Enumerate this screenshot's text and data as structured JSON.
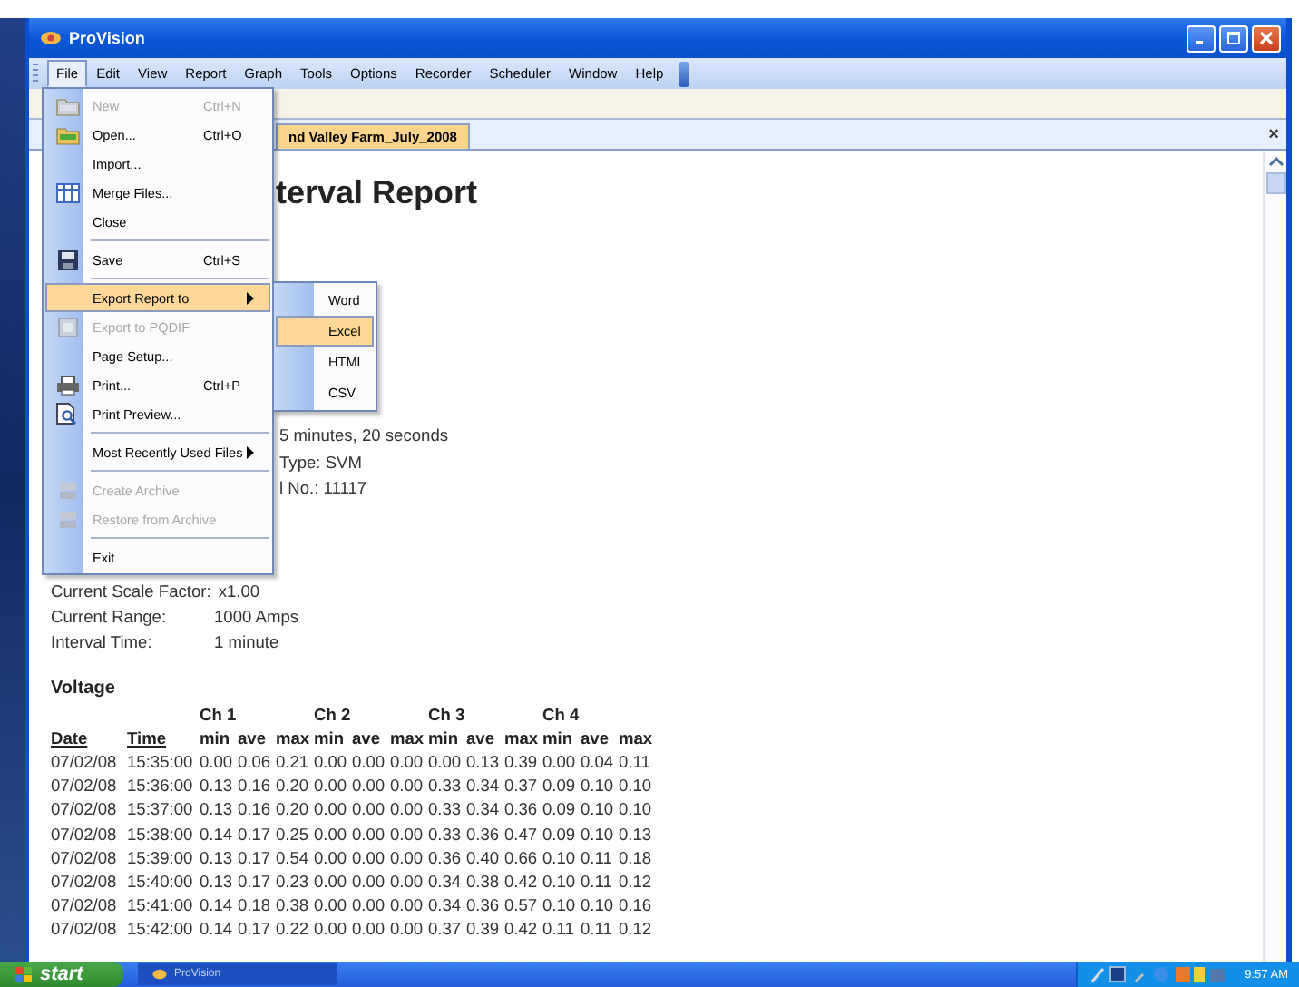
{
  "window": {
    "title": "ProVision"
  },
  "menu_bar": [
    {
      "label": "File",
      "selected": true
    },
    {
      "label": "Edit",
      "selected": false
    },
    {
      "label": "View",
      "selected": false
    },
    {
      "label": "Report",
      "selected": false
    },
    {
      "label": "Graph",
      "selected": false
    },
    {
      "label": "Tools",
      "selected": false
    },
    {
      "label": "Options",
      "selected": false
    },
    {
      "label": "Recorder",
      "selected": false
    },
    {
      "label": "Scheduler",
      "selected": false
    },
    {
      "label": "Window",
      "selected": false
    },
    {
      "label": "Help",
      "selected": false
    }
  ],
  "document_tab": {
    "label": "nd Valley Farm_July_2008",
    "selected": true
  },
  "tab_close": "×",
  "report": {
    "title": "terval Report",
    "info_lines": [
      "5 minutes, 20 seconds",
      "Type:  SVM",
      "l No.: 11117"
    ],
    "settings": [
      {
        "label": "Current Scale Factor:",
        "value": "x1.00"
      },
      {
        "label": "Current Range:",
        "value": "1000 Amps"
      },
      {
        "label": "Interval Time:",
        "value": "1 minute"
      }
    ],
    "section": "Voltage",
    "table": {
      "channels": [
        "Ch 1",
        "Ch 2",
        "Ch 3",
        "Ch 4"
      ],
      "columns": [
        "Date",
        "Time",
        "min",
        "ave",
        "max",
        "min",
        "ave",
        "max",
        "min",
        "ave",
        "max",
        "min",
        "ave",
        "max"
      ],
      "rows": [
        [
          "07/02/08",
          "15:35:00",
          "0.00",
          "0.06",
          "0.21",
          "0.00",
          "0.00",
          "0.00",
          "0.00",
          "0.13",
          "0.39",
          "0.00",
          "0.04",
          "0.11"
        ],
        [
          "07/02/08",
          "15:36:00",
          "0.13",
          "0.16",
          "0.20",
          "0.00",
          "0.00",
          "0.00",
          "0.33",
          "0.34",
          "0.37",
          "0.09",
          "0.10",
          "0.10"
        ],
        [
          "07/02/08",
          "15:37:00",
          "0.13",
          "0.16",
          "0.20",
          "0.00",
          "0.00",
          "0.00",
          "0.33",
          "0.34",
          "0.36",
          "0.09",
          "0.10",
          "0.10"
        ],
        [
          "07/02/08",
          "15:38:00",
          "0.14",
          "0.17",
          "0.25",
          "0.00",
          "0.00",
          "0.00",
          "0.33",
          "0.36",
          "0.47",
          "0.09",
          "0.10",
          "0.13"
        ],
        [
          "07/02/08",
          "15:39:00",
          "0.13",
          "0.17",
          "0.54",
          "0.00",
          "0.00",
          "0.00",
          "0.36",
          "0.40",
          "0.66",
          "0.10",
          "0.11",
          "0.18"
        ],
        [
          "07/02/08",
          "15:40:00",
          "0.13",
          "0.17",
          "0.23",
          "0.00",
          "0.00",
          "0.00",
          "0.34",
          "0.38",
          "0.42",
          "0.10",
          "0.11",
          "0.12"
        ],
        [
          "07/02/08",
          "15:41:00",
          "0.14",
          "0.18",
          "0.38",
          "0.00",
          "0.00",
          "0.00",
          "0.34",
          "0.36",
          "0.57",
          "0.10",
          "0.10",
          "0.16"
        ],
        [
          "07/02/08",
          "15:42:00",
          "0.14",
          "0.17",
          "0.22",
          "0.00",
          "0.00",
          "0.00",
          "0.37",
          "0.39",
          "0.42",
          "0.11",
          "0.11",
          "0.12"
        ]
      ]
    }
  },
  "file_menu": {
    "items": [
      {
        "kind": "item",
        "label": "New",
        "shortcut": "Ctrl+N",
        "disabled": true,
        "selected": false,
        "submenu": false
      },
      {
        "kind": "item",
        "label": "Open...",
        "shortcut": "Ctrl+O",
        "disabled": false,
        "selected": false,
        "submenu": false
      },
      {
        "kind": "item",
        "label": "Import...",
        "disabled": false,
        "selected": false,
        "submenu": false
      },
      {
        "kind": "item",
        "label": "Merge Files...",
        "disabled": false,
        "selected": false,
        "submenu": false
      },
      {
        "kind": "item",
        "label": "Close",
        "disabled": false,
        "selected": false,
        "submenu": false
      },
      {
        "kind": "separator"
      },
      {
        "kind": "item",
        "label": "Save",
        "shortcut": "Ctrl+S",
        "disabled": false,
        "selected": false,
        "submenu": false
      },
      {
        "kind": "separator"
      },
      {
        "kind": "item",
        "label": "Export Report to",
        "disabled": false,
        "selected": true,
        "submenu": true
      },
      {
        "kind": "item",
        "label": "Export to PQDIF",
        "disabled": true,
        "selected": false,
        "submenu": false
      },
      {
        "kind": "item",
        "label": "Page Setup...",
        "disabled": false,
        "selected": false,
        "submenu": false
      },
      {
        "kind": "item",
        "label": "Print...",
        "shortcut": "Ctrl+P",
        "disabled": false,
        "selected": false,
        "submenu": false
      },
      {
        "kind": "item",
        "label": "Print Preview...",
        "disabled": false,
        "selected": false,
        "submenu": false
      },
      {
        "kind": "separator"
      },
      {
        "kind": "item",
        "label": "Most Recently Used Files",
        "disabled": false,
        "selected": false,
        "submenu": true
      },
      {
        "kind": "separator"
      },
      {
        "kind": "item",
        "label": "Create Archive",
        "disabled": true,
        "selected": false,
        "submenu": false
      },
      {
        "kind": "item",
        "label": "Restore from Archive",
        "disabled": true,
        "selected": false,
        "submenu": false
      },
      {
        "kind": "separator"
      },
      {
        "kind": "item",
        "label": "Exit",
        "disabled": false,
        "selected": false,
        "submenu": false
      }
    ]
  },
  "export_submenu": {
    "items": [
      {
        "label": "Word",
        "selected": false
      },
      {
        "label": "Excel",
        "selected": true
      },
      {
        "label": "HTML",
        "selected": false
      },
      {
        "label": "CSV",
        "selected": false
      }
    ]
  },
  "taskbar": {
    "start": "start",
    "task": "ProVision",
    "clock": "9:57 AM"
  }
}
